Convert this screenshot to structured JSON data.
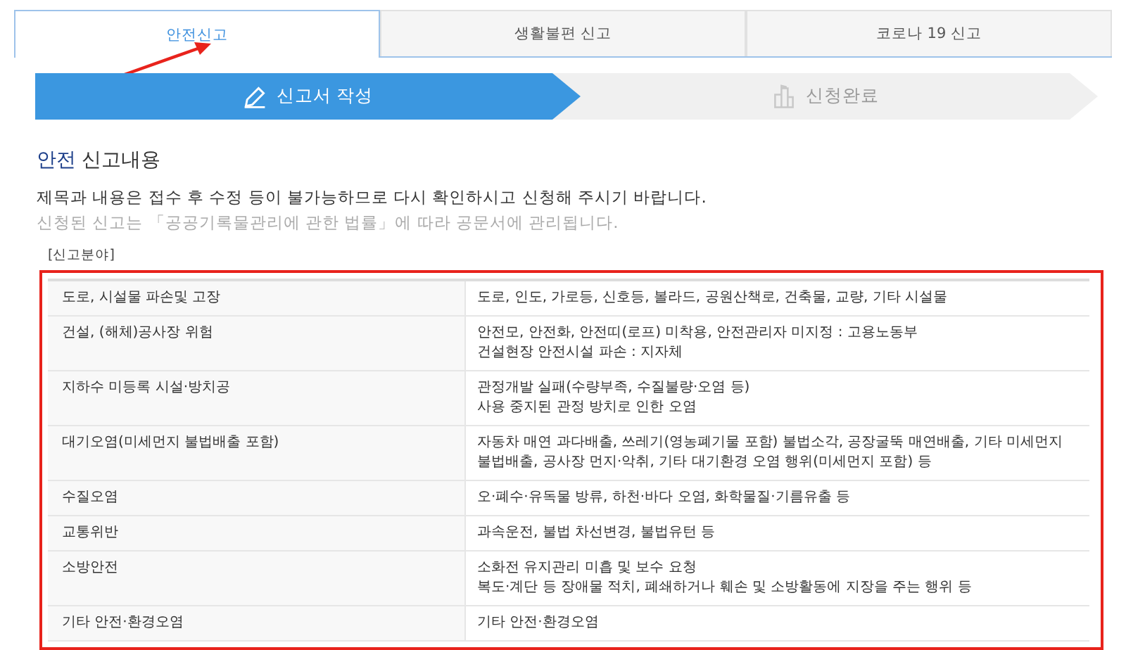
{
  "tabs": [
    {
      "label": "안전신고",
      "selected": true,
      "pointed": true
    },
    {
      "label": "생활불편 신고",
      "selected": false,
      "pointed": false
    },
    {
      "label": "코로나 19 신고",
      "selected": false,
      "pointed": false
    }
  ],
  "steps": [
    {
      "label": "신고서 작성",
      "kind": "write",
      "selected": true
    },
    {
      "label": "신청완료",
      "kind": "done",
      "selected": false
    }
  ],
  "section": {
    "category": "안전",
    "title": "신고내용"
  },
  "notice": "제목과 내용은 접수 후 수정 등이 불가능하므로 다시 확인하시고 신청해 주시기 바랍니다.",
  "subnotice": "신청된 신고는 「공공기록물관리에 관한 법률」에 따라 공문서에 관리됩니다.",
  "field_label": "[신고분야]",
  "table": {
    "highlighted": true,
    "rows": [
      {
        "name": "도로, 시설물 파손및 고장",
        "desc": [
          "도로, 인도, 가로등, 신호등, 볼라드, 공원산책로, 건축물, 교량, 기타 시설물"
        ]
      },
      {
        "name": "건설, (해체)공사장 위험",
        "desc": [
          "안전모, 안전화, 안전띠(로프) 미착용, 안전관리자 미지정 : 고용노동부",
          "건설현장 안전시설 파손 : 지자체"
        ]
      },
      {
        "name": "지하수 미등록 시설·방치공",
        "desc": [
          "관정개발 실패(수량부족, 수질불량·오염 등)",
          "사용 중지된 관정 방치로 인한 오염"
        ]
      },
      {
        "name": "대기오염(미세먼지 불법배출 포함)",
        "desc": [
          "자동차 매연 과다배출, 쓰레기(영농폐기물 포함) 불법소각, 공장굴뚝 매연배출, 기타 미세먼지 불법배출, 공사장 먼지·악취, 기타 대기환경 오염 행위(미세먼지 포함) 등"
        ]
      },
      {
        "name": "수질오염",
        "desc": [
          "오·폐수·유독물 방류, 하천·바다 오염, 화학물질·기름유출 등"
        ]
      },
      {
        "name": "교통위반",
        "desc": [
          "과속운전, 불법 차선변경, 불법유턴 등"
        ]
      },
      {
        "name": "소방안전",
        "desc": [
          "소화전 유지관리 미흡 및 보수 요청",
          "복도·계단 등 장애물 적치, 폐쇄하거나 훼손 및 소방활동에 지장을 주는 행위 등"
        ]
      },
      {
        "name": "기타 안전·환경오염",
        "desc": [
          "기타 안전·환경오염"
        ]
      }
    ]
  }
}
